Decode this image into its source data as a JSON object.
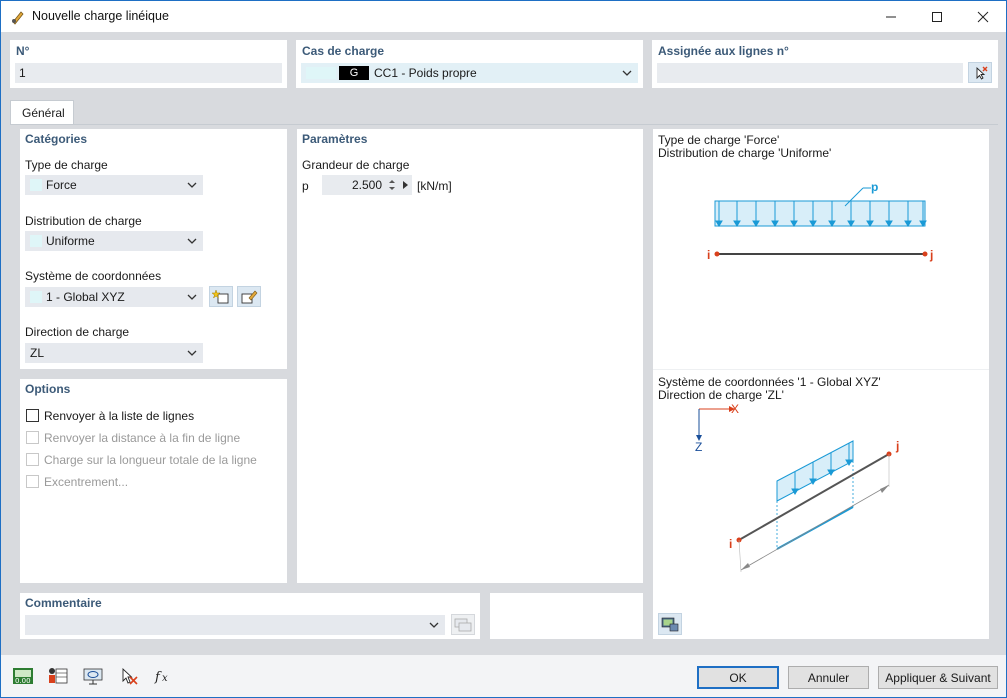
{
  "window": {
    "title": "Nouvelle charge linéique"
  },
  "header": {
    "number_label": "N°",
    "number_value": "1",
    "load_case_label": "Cas de charge",
    "load_case_badge": "G",
    "load_case_value": "CC1 - Poids propre",
    "assigned_label": "Assignée aux lignes n°",
    "assigned_value": ""
  },
  "tabs": [
    {
      "label": "Général"
    }
  ],
  "categories": {
    "title": "Catégories",
    "load_type_label": "Type de charge",
    "load_type_value": "Force",
    "distribution_label": "Distribution de charge",
    "distribution_value": "Uniforme",
    "coord_label": "Système de coordonnées",
    "coord_value": "1 - Global XYZ",
    "direction_label": "Direction de charge",
    "direction_value": "ZL"
  },
  "options": {
    "title": "Options",
    "items": [
      {
        "label": "Renvoyer à la liste de lignes",
        "checked": false,
        "enabled": true
      },
      {
        "label": "Renvoyer la distance à la fin de ligne",
        "checked": false,
        "enabled": false
      },
      {
        "label": "Charge sur la longueur totale de la ligne",
        "checked": false,
        "enabled": false
      },
      {
        "label": "Excentrement...",
        "checked": false,
        "enabled": false
      }
    ]
  },
  "parameters": {
    "title": "Paramètres",
    "magnitude_label": "Grandeur de charge",
    "symbol": "p",
    "value": "2.500",
    "unit": "[kN/m]"
  },
  "preview": {
    "line1": "Type de charge 'Force'",
    "line2": "Distribution de charge 'Uniforme'",
    "p_label": "p",
    "i_label": "i",
    "j_label": "j",
    "coord_line1": "Système de coordonnées '1 - Global XYZ'",
    "coord_line2": "Direction de charge 'ZL'",
    "axis_x": "X",
    "axis_z": "Z"
  },
  "comment": {
    "title": "Commentaire",
    "value": ""
  },
  "buttons": {
    "ok": "OK",
    "cancel": "Annuler",
    "apply_next": "Appliquer & Suivant"
  },
  "colors": {
    "accent": "#1e6fc4",
    "load_blue": "#1a9ad6",
    "node_red": "#d9401c",
    "section_head": "#3c5a78"
  }
}
